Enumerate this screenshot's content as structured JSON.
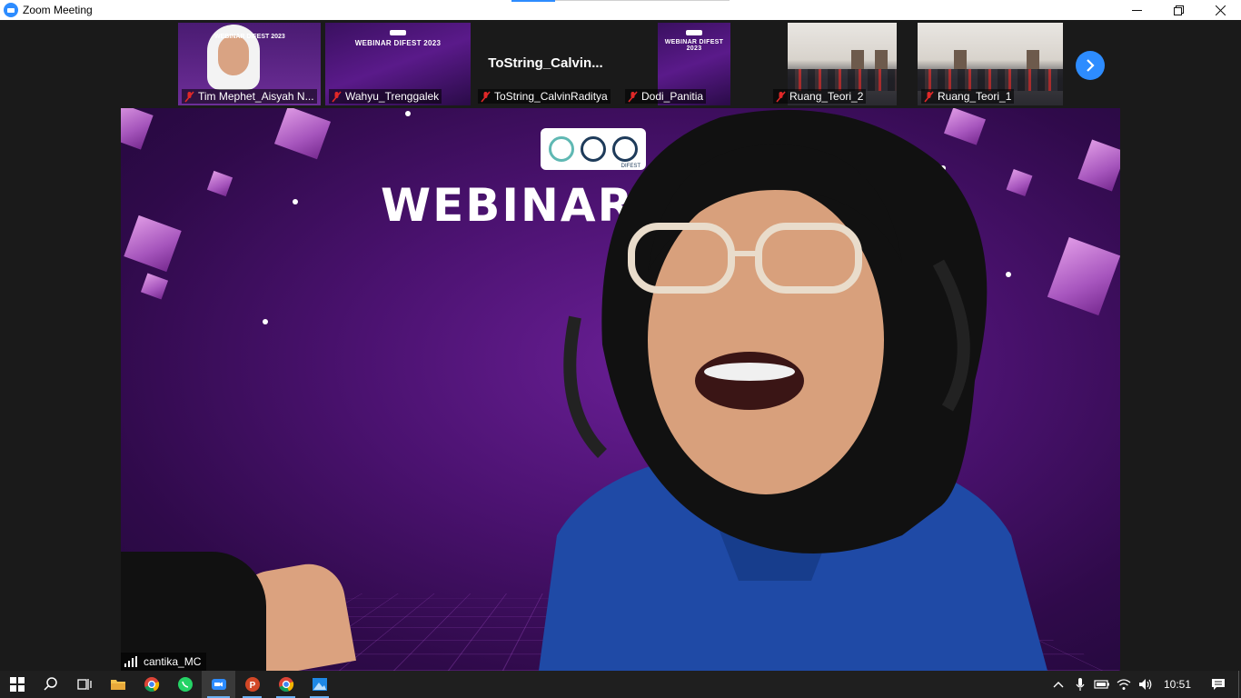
{
  "window": {
    "title": "Zoom Meeting",
    "controls": [
      "minimize",
      "restore",
      "close"
    ]
  },
  "thumbnails": [
    {
      "name": "Tim Mephet_Aisyah N...",
      "type": "video-person",
      "muted": true,
      "slide_title": "WEBINAR DIFEST 2023"
    },
    {
      "name": "Wahyu_Trenggalek",
      "type": "video-slide",
      "muted": true,
      "slide_title": "WEBINAR DIFEST 2023"
    },
    {
      "name": "ToString_CalvinRaditya",
      "type": "no-video",
      "muted": true,
      "display_name": "ToString_Calvin..."
    },
    {
      "name": "Dodi_Panitia",
      "type": "video-slide",
      "muted": true,
      "slide_title": "WEBINAR DIFEST 2023"
    },
    {
      "name": "Ruang_Teori_2",
      "type": "video-room",
      "muted": true
    },
    {
      "name": "Ruang_Teori_1",
      "type": "video-room",
      "muted": true
    }
  ],
  "next_page_icon": "chevron-right-icon",
  "active_speaker": {
    "name": "cantika_MC",
    "background_title": "WEBINAR DI",
    "logo_caption": "DIFEST"
  },
  "taskbar": {
    "apps": [
      "windows-start-icon",
      "search-icon",
      "task-view-icon",
      "file-explorer-icon",
      "chrome-icon",
      "whatsapp-icon",
      "zoom-icon",
      "powerpoint-icon",
      "chrome-icon",
      "photos-icon"
    ],
    "tray": [
      "chevron-up-icon",
      "microphone-icon",
      "battery-icon",
      "wifi-icon",
      "volume-icon"
    ],
    "time": "10:51"
  },
  "colors": {
    "zoom_blue": "#2d8cff",
    "background_purple": "#4b1270",
    "mute_red": "#e02828"
  }
}
